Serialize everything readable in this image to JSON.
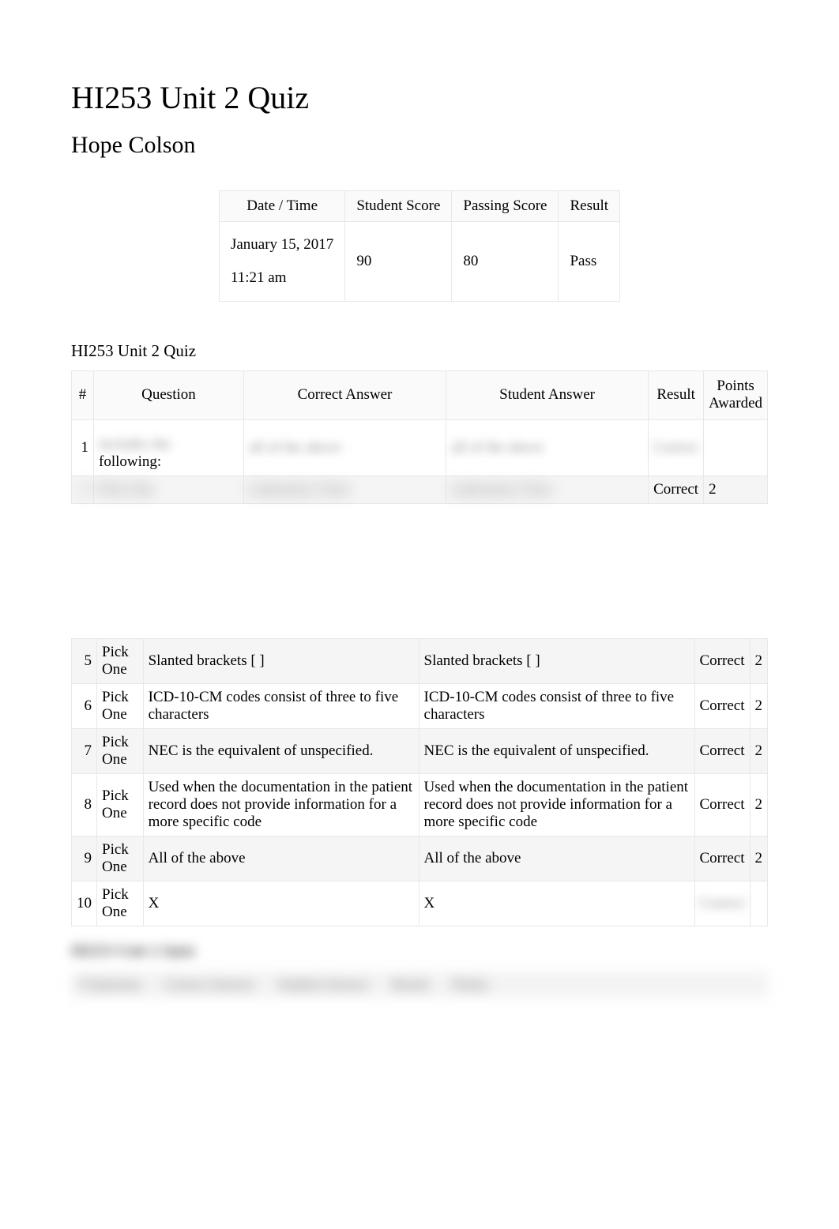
{
  "title": "HI253 Unit 2 Quiz",
  "student_name": "Hope Colson",
  "summary": {
    "headers": {
      "date_time": "Date / Time",
      "student_score": "Student Score",
      "passing_score": "Passing Score",
      "result": "Result"
    },
    "date_line1": "January 15, 2017",
    "date_line2": "11:21 am",
    "student_score": "90",
    "passing_score": "80",
    "result": "Pass"
  },
  "section_title": "HI253 Unit 2 Quiz",
  "questions_headers": {
    "num": "#",
    "question": "Question",
    "correct_answer": "Correct Answer",
    "student_answer": "Student Answer",
    "result": "Result",
    "points": "Points Awarded"
  },
  "top_rows": [
    {
      "num": "1",
      "question_visible": "includes the following:",
      "correct": "all of the above",
      "student": "all of the above",
      "result": "Correct",
      "points": ""
    },
    {
      "num": "",
      "question_visible": "Pick One",
      "correct": "Laboratory Tests",
      "student": "Laboratory Tests",
      "result": "Correct",
      "points": "2"
    }
  ],
  "bottom_rows": [
    {
      "num": "5",
      "question": "Pick One",
      "correct": "Slanted brackets [ ]",
      "student": "Slanted brackets [ ]",
      "result": "Correct",
      "points": "2",
      "alt": true
    },
    {
      "num": "6",
      "question": "Pick One",
      "correct": "ICD-10-CM codes consist of three to five characters",
      "student": "ICD-10-CM codes consist of three to five characters",
      "result": "Correct",
      "points": "2",
      "alt": false
    },
    {
      "num": "7",
      "question": "Pick One",
      "correct": "NEC is the equivalent of unspecified.",
      "student": "NEC is the equivalent of unspecified.",
      "result": "Correct",
      "points": "2",
      "alt": true
    },
    {
      "num": "8",
      "question": "Pick One",
      "correct": "Used when the documentation in the patient record does not provide information for a more specific code",
      "student": "Used when the documentation in the patient record does not provide information for a more specific code",
      "result": "Correct",
      "points": "2",
      "alt": false
    },
    {
      "num": "9",
      "question": "Pick One",
      "correct": "All of the above",
      "student": "All of the above",
      "result": "Correct",
      "points": "2",
      "alt": true
    },
    {
      "num": "10",
      "question": "Pick One",
      "correct": "X",
      "student": "X",
      "result": "",
      "points": "",
      "alt": false
    }
  ],
  "bottom_blur": {
    "title": "HI253 Unit 2 Quiz",
    "cells": [
      "# Question",
      "Correct Answer",
      "Student Answer",
      "Result",
      "Points"
    ]
  }
}
